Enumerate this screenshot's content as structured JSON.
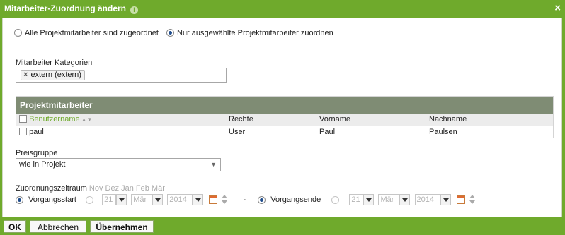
{
  "dialog": {
    "title": "Mitarbeiter-Zuordnung ändern",
    "info_icon": "info-icon",
    "close_icon": "×"
  },
  "assignment": {
    "option_all": "Alle Projektmitarbeiter sind zugeordnet",
    "option_selected": "Nur ausgewählte Projektmitarbeiter zuordnen",
    "selected": "option_selected"
  },
  "categories": {
    "label": "Mitarbeiter Kategorien",
    "tags": [
      "extern (extern)"
    ],
    "remove_glyph": "×"
  },
  "project_staff": {
    "title": "Projektmitarbeiter",
    "columns": [
      "Benutzername",
      "Rechte",
      "Vorname",
      "Nachname"
    ],
    "rows": [
      {
        "username": "paul",
        "rights": "User",
        "first_name": "Paul",
        "last_name": "Paulsen"
      }
    ]
  },
  "price_group": {
    "label": "Preisgruppe",
    "value": "wie in Projekt",
    "caret": "▼"
  },
  "period": {
    "label": "Zuordnungszeitraum",
    "month_hint": "Nov Dez Jan Feb Mär",
    "start_option": "Vorgangsstart",
    "separator": "-",
    "end_option": "Vorgangsende",
    "start_date": {
      "day": "21",
      "month": "Mär",
      "year": "2014"
    },
    "end_date": {
      "day": "21",
      "month": "Mär",
      "year": "2014"
    }
  },
  "footer": {
    "ok": "OK",
    "cancel": "Abbrechen",
    "apply": "Übernehmen"
  },
  "colors": {
    "accent": "#6faa2c",
    "panel_header": "#7f8c74",
    "link": "#6faa2c"
  }
}
